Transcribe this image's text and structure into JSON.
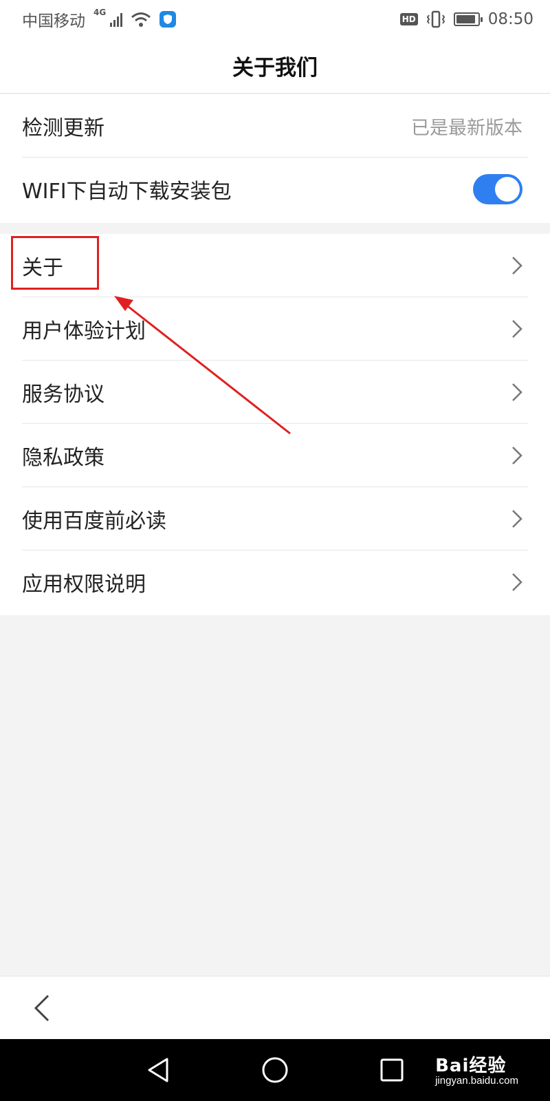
{
  "status_bar": {
    "carrier": "中国移动",
    "network_type": "4G",
    "hd_badge": "HD",
    "time": "08:50"
  },
  "header": {
    "title": "关于我们"
  },
  "settings": {
    "check_update_label": "检测更新",
    "check_update_status": "已是最新版本",
    "wifi_auto_download_label": "WIFI下自动下载安装包",
    "wifi_auto_download_enabled": true
  },
  "menu": [
    {
      "label": "关于",
      "icon": "chevron-right-icon"
    },
    {
      "label": "用户体验计划",
      "icon": "chevron-right-icon"
    },
    {
      "label": "服务协议",
      "icon": "chevron-right-icon"
    },
    {
      "label": "隐私政策",
      "icon": "chevron-right-icon"
    },
    {
      "label": "使用百度前必读",
      "icon": "chevron-right-icon"
    },
    {
      "label": "应用权限说明",
      "icon": "chevron-right-icon"
    }
  ],
  "bottom_bar": {
    "back_icon": "back-arrow-icon"
  },
  "nav_bar": {
    "icons": [
      "nav-back-icon",
      "nav-home-icon",
      "nav-recents-icon"
    ]
  },
  "watermark": {
    "logo_text": "Bai经验",
    "url": "jingyan.baidu.com"
  },
  "colors": {
    "accent": "#2f7ff0",
    "annotation": "#e02020",
    "background": "#f3f3f3"
  }
}
